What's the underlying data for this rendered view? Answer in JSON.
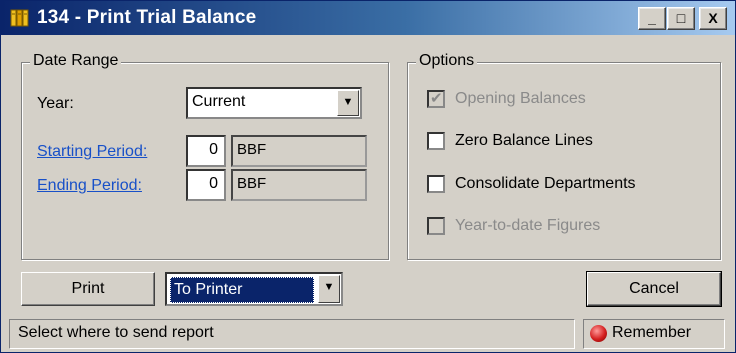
{
  "window": {
    "title": "134 - Print Trial Balance",
    "controls": {
      "minimize": "_",
      "maximize": "□",
      "close": "X"
    }
  },
  "date_range": {
    "legend": "Date Range",
    "year_label": "Year:",
    "year_value": "Current",
    "starting_period_label": "Starting Period:",
    "starting_period_value": "0",
    "starting_period_desc": "BBF",
    "ending_period_label": "Ending Period:",
    "ending_period_value": "0",
    "ending_period_desc": "BBF"
  },
  "options": {
    "legend": "Options",
    "items": [
      {
        "label": "Opening Balances",
        "checked": true,
        "enabled": false
      },
      {
        "label": "Zero Balance Lines",
        "checked": false,
        "enabled": true
      },
      {
        "label": "Consolidate Departments",
        "checked": false,
        "enabled": true
      },
      {
        "label": "Year-to-date Figures",
        "checked": false,
        "enabled": false
      }
    ]
  },
  "buttons": {
    "print": "Print",
    "cancel": "Cancel"
  },
  "destination": {
    "value": "To Printer"
  },
  "status_bar": {
    "message": "Select where to send report",
    "remember": "Remember"
  },
  "icons": {
    "app": "ledger-books-icon",
    "dropdown": "chevron-down-icon",
    "remember": "red-light-icon",
    "check": "checkmark-icon"
  },
  "colors": {
    "titlebar_start": "#0a246a",
    "titlebar_end": "#a6caf0",
    "link": "#1850c8",
    "selected_bg": "#0a246a",
    "dialog_bg": "#d4d0c8"
  }
}
